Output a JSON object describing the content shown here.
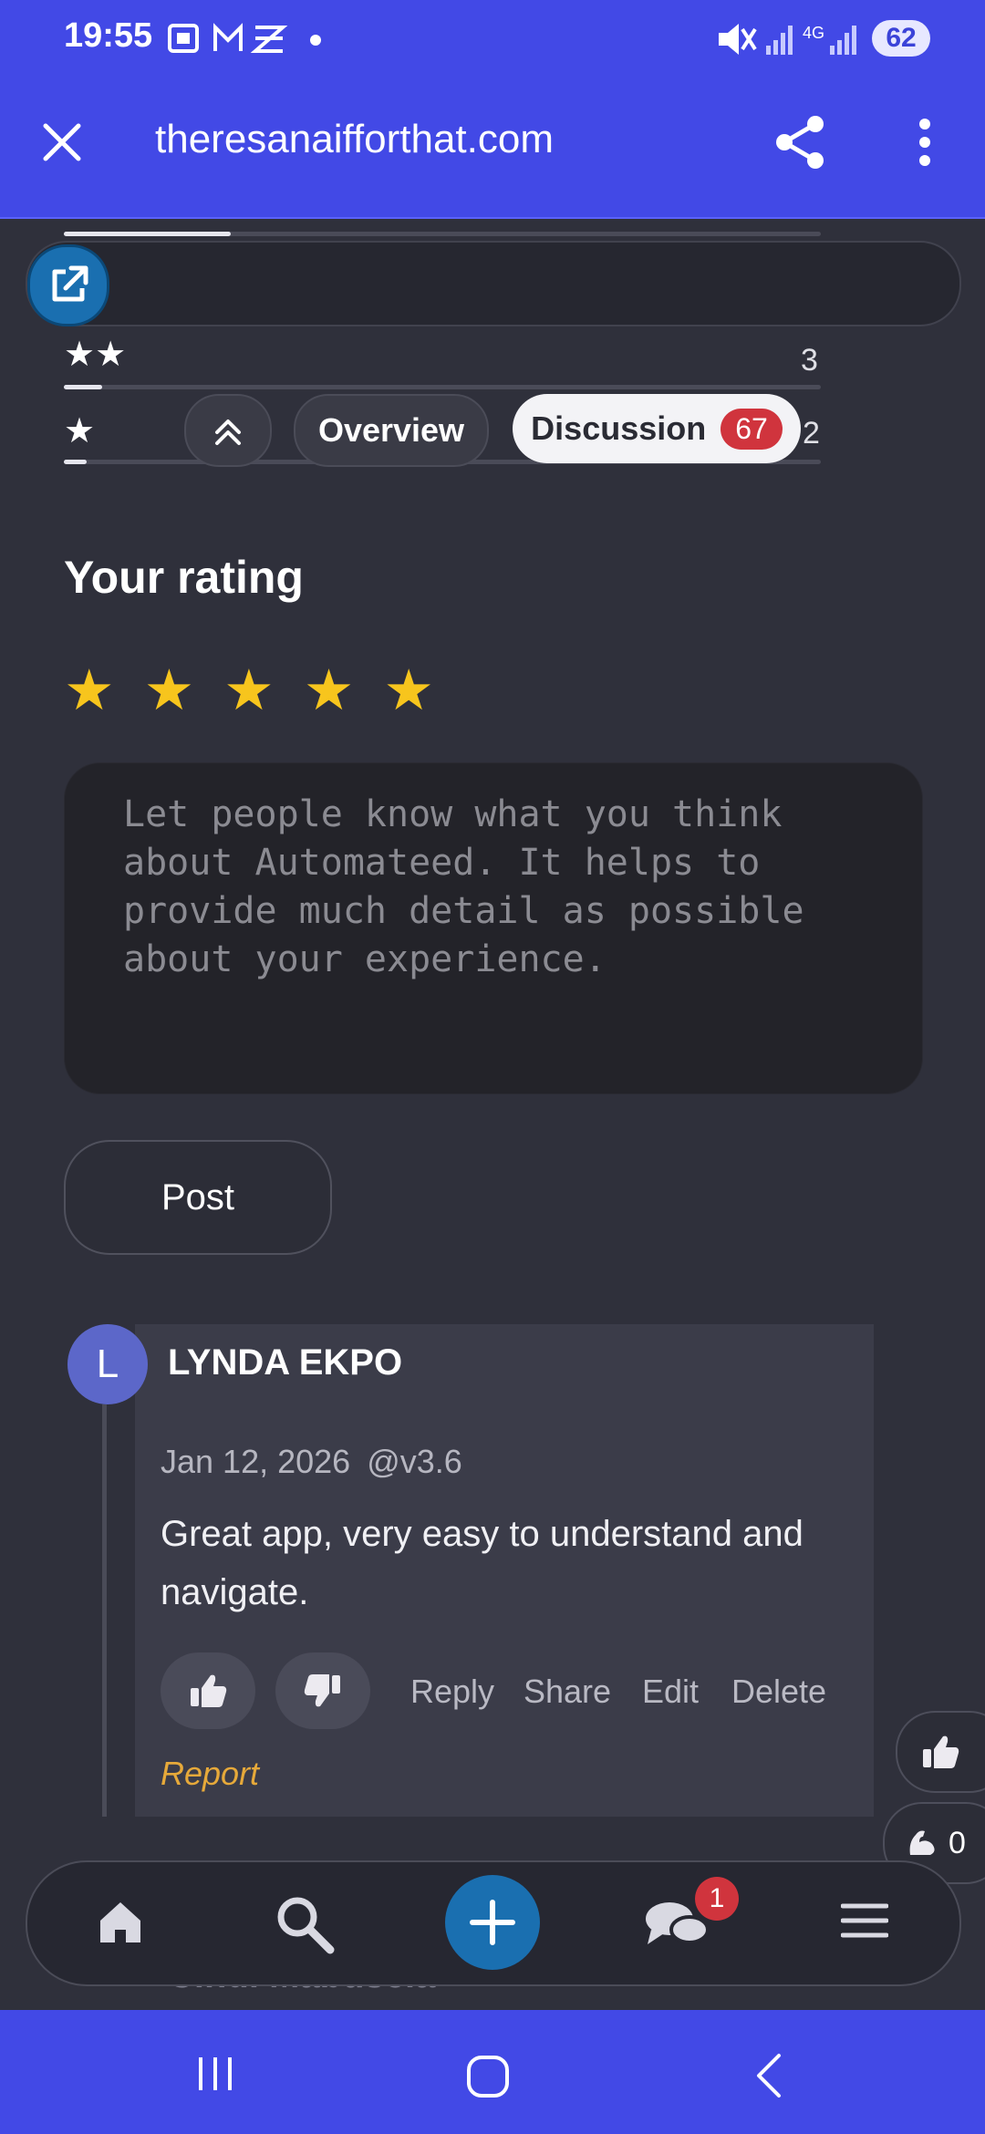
{
  "status_bar": {
    "time": "19:55",
    "network": "4G",
    "battery": "62"
  },
  "browser": {
    "url": "theresanaifforthat.com",
    "close_icon": "close-icon",
    "share_icon": "share-icon",
    "menu_icon": "more-vertical-icon"
  },
  "rating_breakdown": [
    {
      "stars": "★★★★",
      "count": "",
      "fraction": 0.22
    },
    {
      "stars": "★★",
      "count": "3",
      "fraction": 0.05
    },
    {
      "stars": "★",
      "count": "2",
      "fraction": 0.03
    }
  ],
  "tabs": {
    "overview": "Overview",
    "discussion": "Discussion",
    "discussion_count": "67"
  },
  "your_rating": {
    "title": "Your rating",
    "stars": "★★★★★",
    "placeholder": "Let people know what you think about Automateed. It helps to provide much detail as possible about your experience.",
    "post_label": "Post"
  },
  "comment": {
    "avatar_letter": "L",
    "author": "LYNDA EKPO",
    "date": "Jan 12, 2026",
    "version": "@v3.6",
    "text": "Great app, very easy to understand and navigate.",
    "actions": [
      "Reply",
      "Share",
      "Edit",
      "Delete"
    ],
    "report": "Report"
  },
  "side_reactions": {
    "flex_count": "0"
  },
  "next_comment_author": "Cindi Mabuseia",
  "bottom_nav": {
    "messages_badge": "1"
  },
  "colors": {
    "accent": "#4249e6",
    "star": "#f7c51d",
    "badge": "#d0343d",
    "report": "#e6a93a"
  }
}
